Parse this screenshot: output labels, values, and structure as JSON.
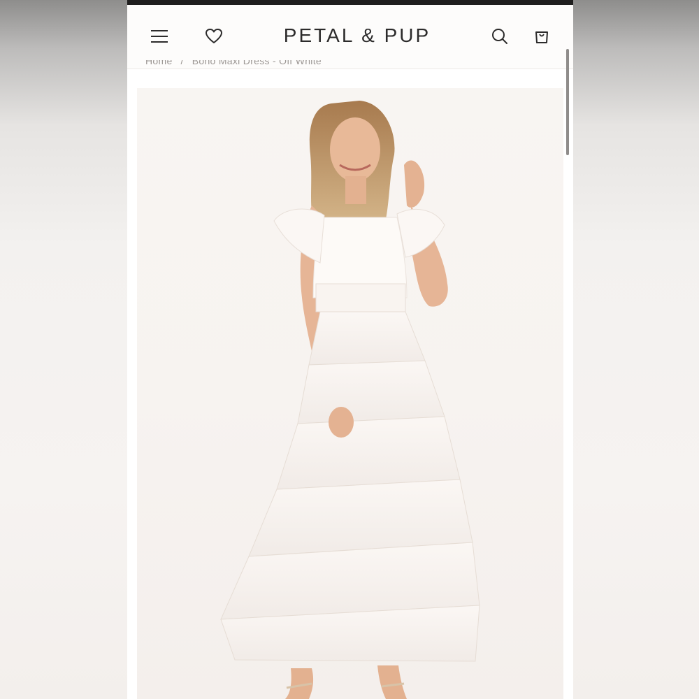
{
  "brand": {
    "logo": "PETAL & PUP"
  },
  "header": {
    "menu_icon": "hamburger-menu-icon",
    "wishlist_icon": "heart-icon",
    "search_icon": "search-icon",
    "cart_icon": "shopping-bag-icon"
  },
  "breadcrumb": {
    "home": "Home",
    "current": "Boho Maxi Dress - Off White"
  },
  "product": {
    "image_alt": "Model wearing white tiered tulle maxi dress with flutter sleeves"
  },
  "colors": {
    "topbar": "#1f1e1e",
    "header_bg": "#fdfcfb",
    "logo_text": "#2c2b2b"
  }
}
